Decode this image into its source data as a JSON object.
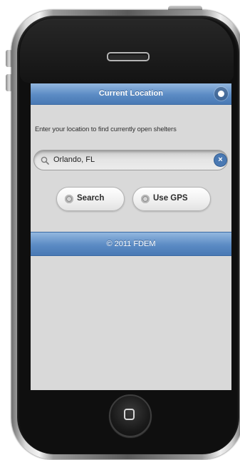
{
  "colors": {
    "header_blue": "#5b8bc4",
    "screen_background": "#d9d9d9",
    "phone_black": "#0f0f0f"
  },
  "header": {
    "title": "Current Location",
    "info_icon": "info-icon"
  },
  "main": {
    "instruction": "Enter your location to find currently open shelters",
    "search": {
      "value": "Orlando, FL",
      "icon": "search-icon",
      "clear_icon": "clear-icon"
    },
    "buttons": {
      "search_label": "Search",
      "gps_label": "Use GPS",
      "icon": "radio-icon"
    }
  },
  "footer": {
    "text": "© 2011 FDEM"
  },
  "device": {
    "home_icon": "home-button-icon"
  }
}
